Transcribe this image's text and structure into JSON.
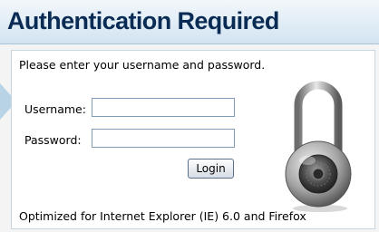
{
  "header": {
    "title": "Authentication Required"
  },
  "form": {
    "instructions": "Please enter your username and password.",
    "username_label": "Username:",
    "username_value": "",
    "password_label": "Password:",
    "password_value": "",
    "login_label": "Login"
  },
  "footer": {
    "note": "Optimized for Internet Explorer (IE) 6.0 and Firefox"
  },
  "icons": {
    "lock": "combination-padlock-icon"
  },
  "colors": {
    "title": "#0a2c54",
    "header_top": "#f2f7fb",
    "header_bottom": "#d2e4f1",
    "input_border": "#7f9db9"
  }
}
